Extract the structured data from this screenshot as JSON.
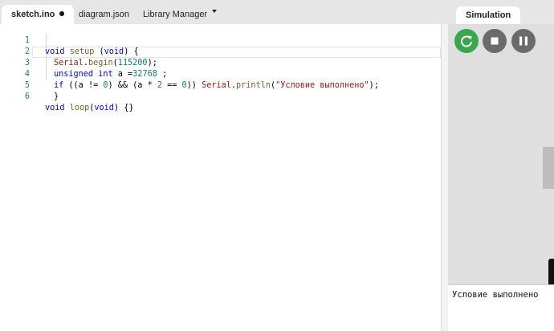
{
  "tabs": [
    {
      "label": "sketch.ino",
      "active": true,
      "modified": true
    },
    {
      "label": "diagram.json"
    },
    {
      "label": "Library Manager"
    }
  ],
  "code": {
    "line_numbers": [
      "1",
      "2",
      "3",
      "4",
      "5",
      "6"
    ],
    "l1": {
      "a": "void",
      "b": " ",
      "c": "setup",
      "d": " (",
      "e": "void",
      "f": ") {"
    },
    "l2": {
      "a": "Serial",
      "b": ".",
      "c": "begin",
      "d": "(",
      "e": "115200",
      "f": ");"
    },
    "l3": {
      "a": "unsigned",
      "b": " ",
      "c": "int",
      "d": " a =",
      "e": "32768",
      "f": " ;"
    },
    "l4": {
      "a": "if",
      "b": " ((a != ",
      "c": "0",
      "d": ") && (a * ",
      "e": "2",
      "f": " == ",
      "g": "0",
      "h": ")) ",
      "i": "Serial",
      "j": ".",
      "k": "println",
      "l": "(",
      "m": "\"Условие выполнено\"",
      "n": ");"
    },
    "l5": {
      "a": "}"
    },
    "l6": {
      "a": "void",
      "b": " ",
      "c": "loop",
      "d": "(",
      "e": "void",
      "f": ") {}"
    }
  },
  "simulation": {
    "tab_label": "Simulation",
    "serial_output": "Условие выполнено"
  },
  "colors": {
    "restart": "#3aa64d",
    "control": "#6b6b6b",
    "keyword": "#0000ff",
    "serial": "#a31515",
    "number": "#098658"
  },
  "icons": {
    "restart": "restart-icon",
    "stop": "stop-icon",
    "pause": "pause-icon",
    "dropdown": "chevron-down-icon",
    "modified": "unsaved-dot-icon"
  }
}
